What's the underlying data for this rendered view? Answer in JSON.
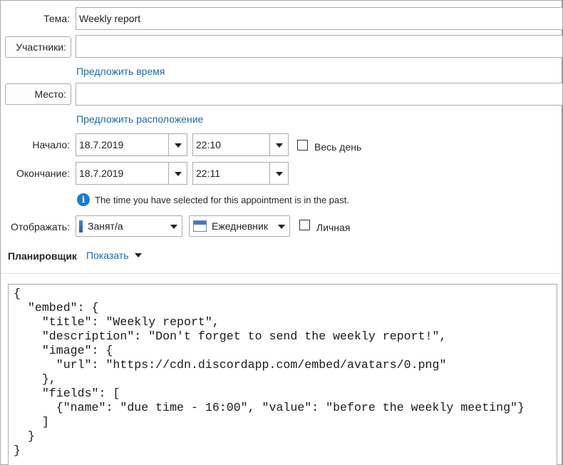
{
  "subject": {
    "label": "Тема:",
    "value": "Weekly report"
  },
  "participants": {
    "button": "Участники:",
    "value": "",
    "suggest_link": "Предложить время"
  },
  "location": {
    "button": "Место:",
    "value": "",
    "suggest_link": "Предложить расположение"
  },
  "start": {
    "label": "Начало:",
    "date": "18.7.2019",
    "time": "22:10",
    "all_day_label": "Весь день",
    "all_day_checked": false
  },
  "end": {
    "label": "Окончание:",
    "date": "18.7.2019",
    "time": "22:11"
  },
  "info": {
    "icon": "info-icon",
    "text": "The time you have selected for this appointment is in the past."
  },
  "show_as": {
    "label": "Отображать:",
    "value": "Занят/а",
    "calendar": "Ежедневник",
    "private_label": "Личная",
    "private_checked": false
  },
  "scheduler": {
    "label": "Планировщик",
    "show_link": "Показать"
  },
  "body_text": "{\n  \"embed\": {\n    \"title\": \"Weekly report\",\n    \"description\": \"Don't forget to send the weekly report!\",\n    \"image\": {\n      \"url\": \"https://cdn.discordapp.com/embed/avatars/0.png\"\n    },\n    \"fields\": [\n      {\"name\": \"due time - 16:00\", \"value\": \"before the weekly meeting\"}\n    ]\n  }\n}",
  "colors": {
    "link": "#1f66a8",
    "info_icon": "#1e79d3",
    "border": "#ababab"
  }
}
